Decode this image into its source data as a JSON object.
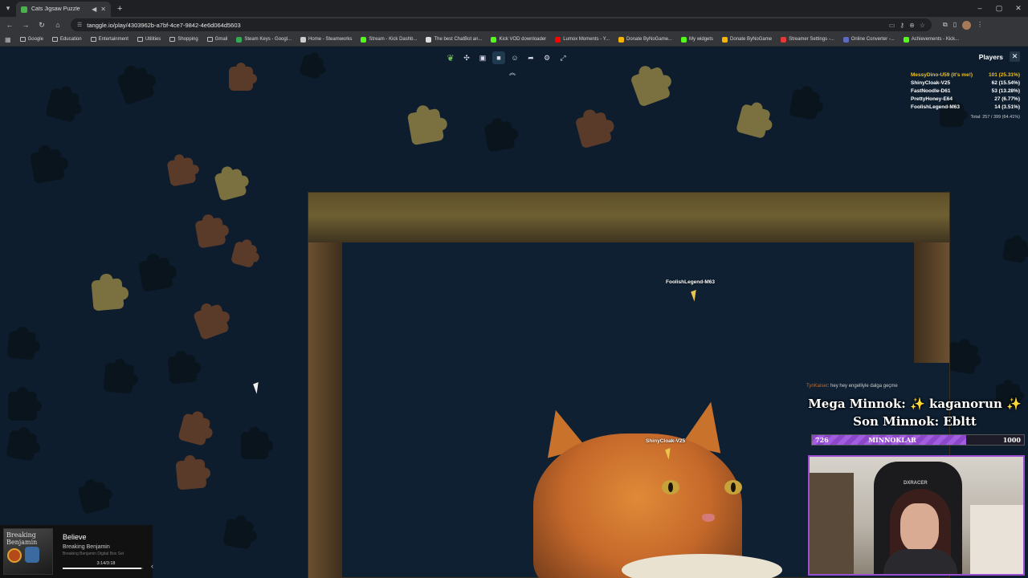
{
  "browser": {
    "tab_title": "Cats Jigsaw Puzzle",
    "url": "tanggle.io/play/4303962b-a7bf-4ce7-9842-4e6d064d5603",
    "bookmarks": [
      {
        "label": "Google",
        "kind": "folder"
      },
      {
        "label": "Education",
        "kind": "folder"
      },
      {
        "label": "Entertainment",
        "kind": "folder"
      },
      {
        "label": "Utilities",
        "kind": "folder"
      },
      {
        "label": "Shopping",
        "kind": "folder"
      },
      {
        "label": "Gmail",
        "kind": "folder"
      },
      {
        "label": "Steam Keys - Googl...",
        "kind": "site",
        "color": "#34a853"
      },
      {
        "label": "Home - Steamworks",
        "kind": "site",
        "color": "#cccccc"
      },
      {
        "label": "Stream - Kick Dashb...",
        "kind": "site",
        "color": "#53fc18"
      },
      {
        "label": "The best ChatBot an...",
        "kind": "site",
        "color": "#dddddd"
      },
      {
        "label": "Kick VOD downloader",
        "kind": "site",
        "color": "#53fc18"
      },
      {
        "label": "Lumox Moments - Y...",
        "kind": "site",
        "color": "#ff0000"
      },
      {
        "label": "Donate ByNoGame...",
        "kind": "site",
        "color": "#f4b400"
      },
      {
        "label": "My widgets",
        "kind": "site",
        "color": "#53fc18"
      },
      {
        "label": "Donate ByNoGame",
        "kind": "site",
        "color": "#f4b400"
      },
      {
        "label": "Streamer Settings -...",
        "kind": "site",
        "color": "#e53935"
      },
      {
        "label": "Online Converter -...",
        "kind": "site",
        "color": "#5c6bc0"
      },
      {
        "label": "Achievements - Kick...",
        "kind": "site",
        "color": "#53fc18"
      }
    ]
  },
  "players": {
    "title": "Players",
    "rows": [
      {
        "name": "MessyDino-U59 (it's me!)",
        "score": "101 (25.31%)",
        "me": true
      },
      {
        "name": "ShinyCloak-V25",
        "score": "62 (15.54%)",
        "me": false
      },
      {
        "name": "FastNoodle-D61",
        "score": "53 (13.28%)",
        "me": false
      },
      {
        "name": "PrettyHoney-E64",
        "score": "27 (6.77%)",
        "me": false
      },
      {
        "name": "FoolishLegend-M63",
        "score": "14 (3.51%)",
        "me": false
      }
    ],
    "total": "Total: 257 / 399 (64.41%)"
  },
  "cursors": {
    "foolish": "FoolishLegend-M63",
    "shiny": "ShinyCloak-V25"
  },
  "stream": {
    "chat_nick": "TynKaiser",
    "chat_text": ": hey hey engelliyle dalga geçme",
    "mega_line": "Mega Minnok: ✨ kaganorun ✨",
    "son_line": "Son Minnok: Ebltt",
    "bar_label": "MINNOKLAR",
    "bar_current": "726",
    "bar_max": "1000",
    "bar_progress": 0.726,
    "chair_brand": "DXRACER"
  },
  "music": {
    "album_text": "Breaking Benjamin",
    "title": "Believe",
    "artist": "Breaking Benjamin",
    "album": "Breaking Benjamin Digital Box Set",
    "time": "3:14/3:18",
    "progress": 0.98
  }
}
